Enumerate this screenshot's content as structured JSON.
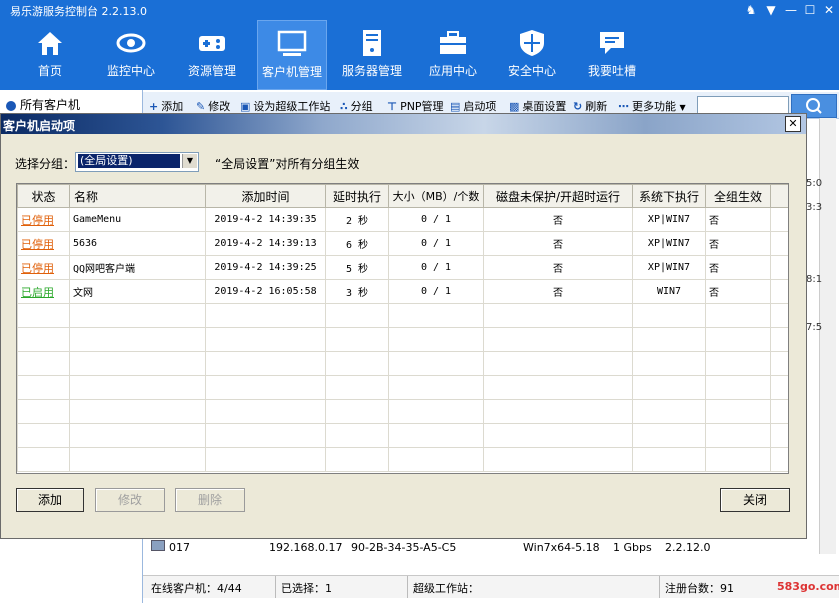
{
  "app": {
    "title": "易乐游服务控制台 2.2.13.0"
  },
  "nav": [
    {
      "label": "首页"
    },
    {
      "label": "监控中心"
    },
    {
      "label": "资源管理"
    },
    {
      "label": "客户机管理"
    },
    {
      "label": "服务器管理"
    },
    {
      "label": "应用中心"
    },
    {
      "label": "安全中心"
    },
    {
      "label": "我要吐槽"
    }
  ],
  "sidebar": {
    "root_label": "所有客户机"
  },
  "toolbar": {
    "add": "添加",
    "edit": "修改",
    "set_super": "设为超级工作站",
    "group": "分组",
    "pnp": "PNP管理",
    "startup": "启动项",
    "desktop": "桌面设置",
    "refresh": "刷新",
    "more": "更多功能"
  },
  "bg_row": {
    "name": "017",
    "ip": "192.168.0.17",
    "mac": "90-2B-34-35-A5-C5",
    "os": "Win7x64-5.18",
    "speed": "1 Gbps",
    "ver": "2.2.12.0"
  },
  "statusbar": {
    "online": "在线客户机：4/44",
    "selected": "已选择：1",
    "super": "超级工作站：",
    "registered": "注册台数：91",
    "watermark": "583go.com"
  },
  "right_edge_values": [
    "5:0",
    "3:3",
    "8:1",
    "7:5"
  ],
  "dialog": {
    "title": "客户机启动项",
    "group_label": "选择分组：",
    "group_value": "(全局设置)",
    "group_hint": "“全局设置”对所有分组生效",
    "columns": [
      "状态",
      "名称",
      "添加时间",
      "延时执行",
      "大小（MB）/个数",
      "磁盘未保护/开超时运行",
      "系统下执行",
      "全组生效"
    ],
    "rows": [
      {
        "status": "已停用",
        "status_color": "#e0600a",
        "name": "GameMenu",
        "time": "2019-4-2 14:39:35",
        "delay": "2 秒",
        "size": "0 / 1",
        "disk": "否",
        "sys": "XP|WIN7",
        "all": "否"
      },
      {
        "status": "已停用",
        "status_color": "#e0600a",
        "name": "5636",
        "time": "2019-4-2 14:39:13",
        "delay": "6 秒",
        "size": "0 / 1",
        "disk": "否",
        "sys": "XP|WIN7",
        "all": "否"
      },
      {
        "status": "已停用",
        "status_color": "#e0600a",
        "name": "QQ网吧客户端",
        "time": "2019-4-2 14:39:25",
        "delay": "5 秒",
        "size": "0 / 1",
        "disk": "否",
        "sys": "XP|WIN7",
        "all": "否"
      },
      {
        "status": "已启用",
        "status_color": "#2aa82a",
        "name": "文网",
        "time": "2019-4-2 16:05:58",
        "delay": "3 秒",
        "size": "0 / 1",
        "disk": "否",
        "sys": "WIN7",
        "all": "否"
      }
    ],
    "buttons": {
      "add": "添加",
      "edit": "修改",
      "delete": "删除",
      "close": "关闭"
    }
  }
}
